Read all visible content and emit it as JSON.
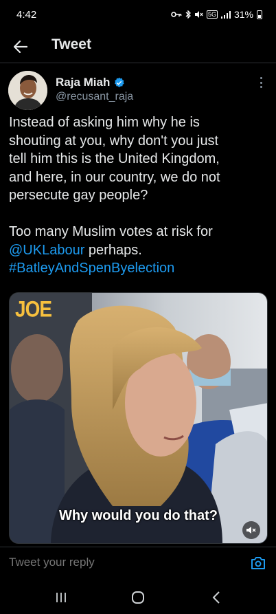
{
  "status_bar": {
    "time": "4:42",
    "network": "5G",
    "battery": "31%",
    "icons": [
      "vpn-key-icon",
      "bluetooth-icon",
      "mute-icon",
      "signal-icon",
      "battery-icon"
    ]
  },
  "header": {
    "title": "Tweet",
    "back_icon": "arrow-left-icon"
  },
  "tweet": {
    "author": {
      "name": "Raja Miah",
      "handle": "@recusant_raja",
      "verified": true
    },
    "text_lines": [
      "Instead of asking him why he is",
      "shouting at you, why don't you just",
      "tell him this is the United Kingdom,",
      "and here, in our country, we do not",
      "persecute gay people?"
    ],
    "text_line2a": "Too many Muslim votes at risk for",
    "mention": "@UKLabour",
    "after_mention": " perhaps.",
    "hashtag": "#BatleyAndSpenByelection",
    "media": {
      "logo": "JOE",
      "caption": "Why would you do that?",
      "mute_icon": "volume-muted-icon"
    }
  },
  "reply": {
    "placeholder": "Tweet your reply",
    "camera_icon": "camera-icon"
  },
  "colors": {
    "background": "#000000",
    "text": "#e7e9ea",
    "secondary": "#8b98a5",
    "accent": "#1d9bf0",
    "logo": "#f7c03e"
  }
}
